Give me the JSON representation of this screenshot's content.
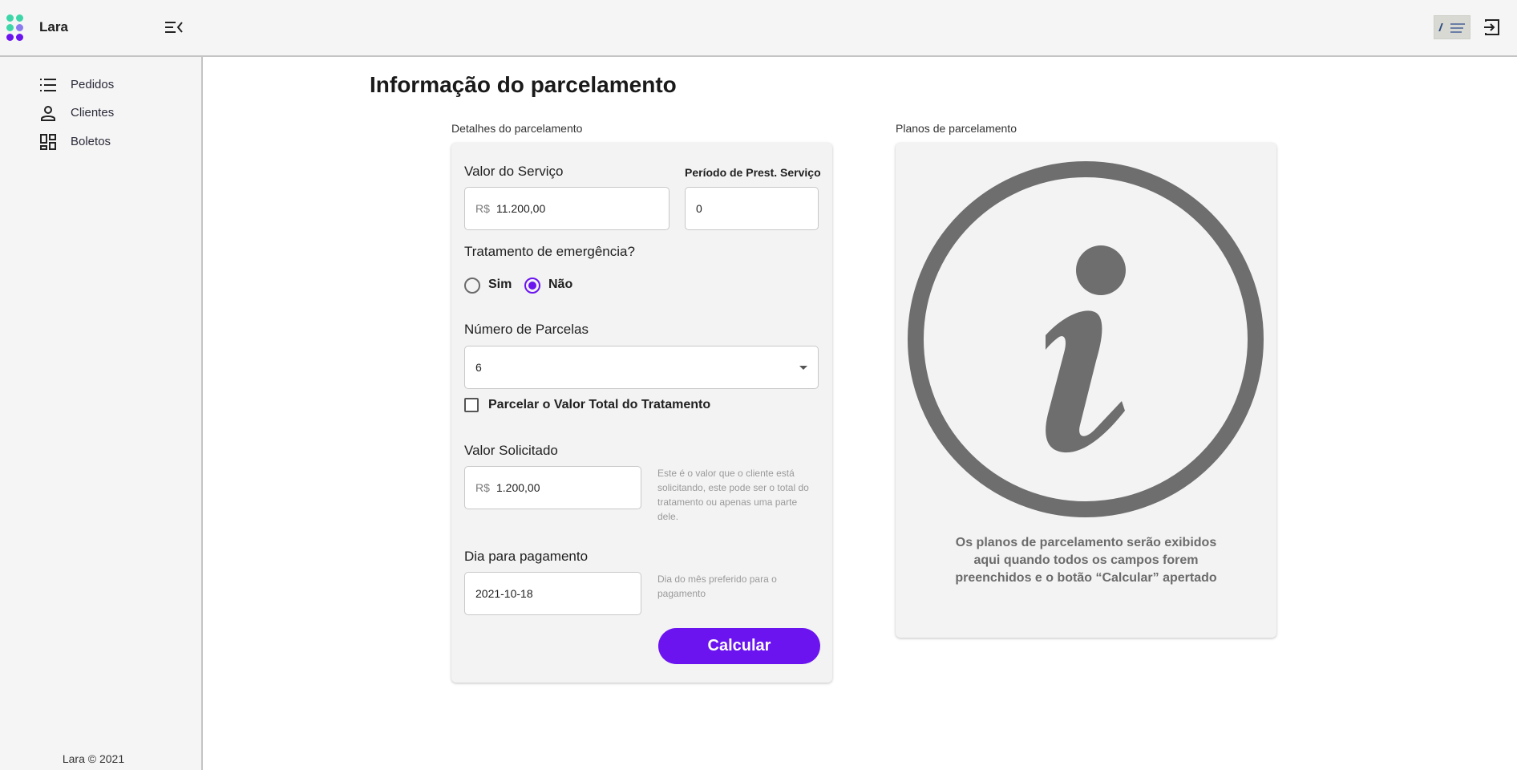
{
  "app": {
    "title": "Lara"
  },
  "colors": {
    "accent": "#6b14f0",
    "logo_dots": [
      "#3dd6a8",
      "#3dd6a8",
      "#3dd6a8",
      "#8a7cf0",
      "#6b14f0",
      "#6b14f0"
    ]
  },
  "header": {
    "menu_icon": "menu-collapse-icon",
    "logout_icon": "logout-icon",
    "company_logo": "company-logo"
  },
  "sidebar": {
    "items": [
      {
        "label": "Pedidos",
        "icon": "list-icon"
      },
      {
        "label": "Clientes",
        "icon": "person-icon"
      },
      {
        "label": "Boletos",
        "icon": "dashboard-icon"
      }
    ],
    "footer": "Lara © 2021"
  },
  "main": {
    "title": "Informação do parcelamento",
    "details": {
      "section_label": "Detalhes do parcelamento",
      "valor_servico": {
        "label": "Valor do Serviço",
        "prefix": "R$",
        "value": "11.200,00"
      },
      "periodo": {
        "label": "Período de Prest. Serviço",
        "value": "0"
      },
      "emergencia": {
        "label": "Tratamento de emergência?",
        "options": [
          "Sim",
          "Não"
        ],
        "selected": "Não"
      },
      "parcelas": {
        "label": "Número de Parcelas",
        "value": "6"
      },
      "parcelar_total": {
        "label": "Parcelar o Valor Total do Tratamento",
        "checked": false
      },
      "valor_solicitado": {
        "label": "Valor Solicitado",
        "prefix": "R$",
        "value": "1.200,00",
        "hint": "Este é o valor que o cliente está solicitando, este pode ser o total do tratamento ou apenas uma parte dele."
      },
      "dia_pagamento": {
        "label": "Dia para pagamento",
        "value": "2021-10-18",
        "hint": "Dia do mês preferido para o pagamento"
      },
      "calcular_label": "Calcular"
    },
    "plans": {
      "section_label": "Planos de parcelamento",
      "icon": "info-icon",
      "message": "Os planos de parcelamento serão exibidos aqui quando todos os campos forem preenchidos e o botão “Calcular” apertado"
    }
  }
}
